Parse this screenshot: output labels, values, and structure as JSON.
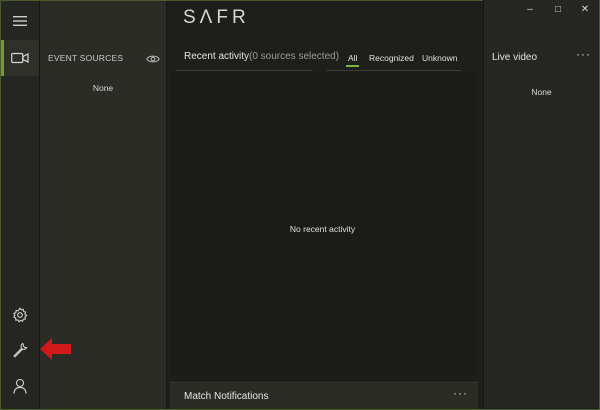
{
  "app": {
    "logo_text": "SΛFR"
  },
  "window_controls": {
    "minimize": "–",
    "maximize": "□",
    "close": "✕"
  },
  "rail": {
    "icons": [
      "menu-icon",
      "camera-icon",
      "gear-icon",
      "wrench-icon",
      "user-icon"
    ],
    "accent": "#6fa02d"
  },
  "sources": {
    "title": "EVENT SOURCES",
    "empty_text": "None"
  },
  "activity": {
    "title": "Recent activity",
    "count": "(0 sources selected)",
    "filters": [
      "All",
      "Recognized",
      "Unknown"
    ],
    "active_filter": "All",
    "empty_text": "No recent activity"
  },
  "match_notifications": {
    "title": "Match Notifications",
    "more": "···"
  },
  "live_video": {
    "title": "Live video",
    "more": "···",
    "empty_text": "None"
  },
  "colors": {
    "accent": "#7cb342",
    "arrow": "#d01919",
    "window_border": "#4a5a2c"
  }
}
